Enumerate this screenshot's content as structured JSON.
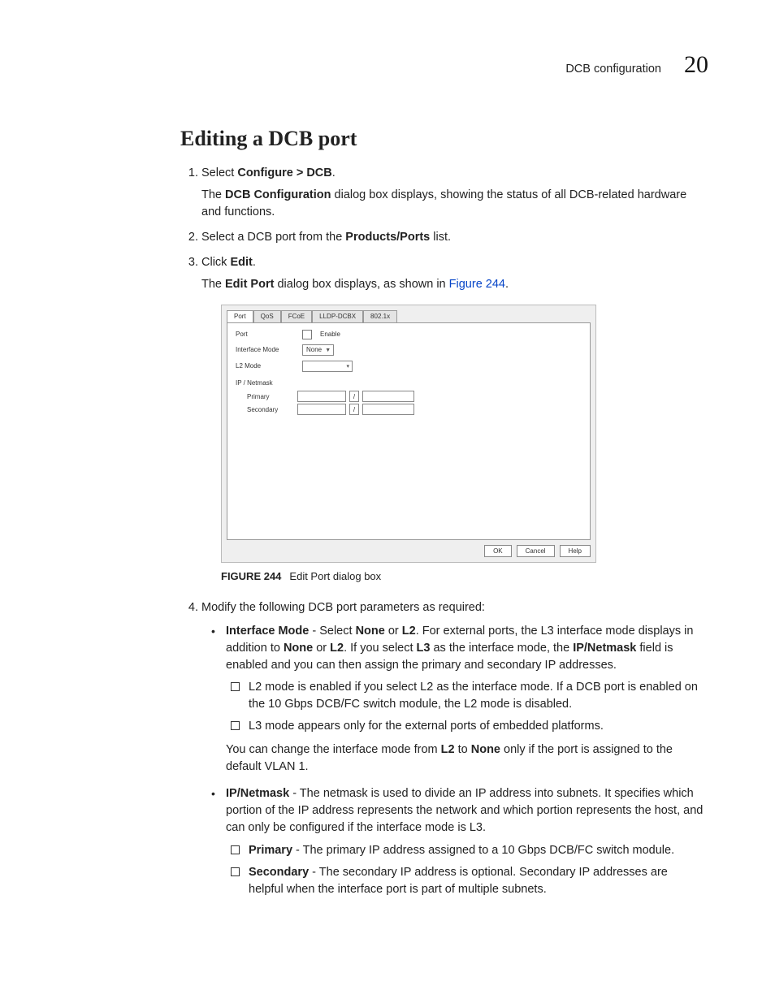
{
  "header": {
    "section": "DCB configuration",
    "chapter": "20"
  },
  "title": "Editing a DCB port",
  "steps": {
    "s1": {
      "text_a": "Select ",
      "bold": "Configure > DCB",
      "text_b": "."
    },
    "s1_para": {
      "a": "The ",
      "b": "DCB Configuration",
      "c": " dialog box displays, showing the status of all DCB-related hardware and functions."
    },
    "s2": {
      "a": "Select a DCB port from the ",
      "b": "Products/Ports",
      "c": " list."
    },
    "s3": {
      "a": "Click ",
      "b": "Edit",
      "c": "."
    },
    "s3_para": {
      "a": "The ",
      "b": "Edit Port",
      "c": " dialog box displays, as shown in ",
      "link": "Figure 244",
      "d": "."
    },
    "s4": "Modify the following DCB port parameters as required:"
  },
  "figure": {
    "tabs": [
      "Port",
      "QoS",
      "FCoE",
      "LLDP-DCBX",
      "802.1x"
    ],
    "labels": {
      "port": "Port",
      "enable": "Enable",
      "ifmode": "Interface Mode",
      "ifmode_val": "None",
      "l2mode": "L2 Mode",
      "ipnet": "IP / Netmask",
      "primary": "Primary",
      "secondary": "Secondary",
      "slash": "/"
    },
    "buttons": {
      "ok": "OK",
      "cancel": "Cancel",
      "help": "Help"
    },
    "caption_num": "FIGURE 244",
    "caption_text": "Edit Port dialog box"
  },
  "bullets": {
    "b1": {
      "lead": "Interface Mode",
      "t1": " - Select ",
      "none": "None",
      "or": " or ",
      "l2": "L2",
      "t2": ". For external ports, the L3 interface mode displays in addition to ",
      "t3": ". If you select ",
      "l3": "L3",
      "t4": " as the interface mode, the ",
      "ipn": "IP/Netmask",
      "t5": " field is enabled and you can then assign the primary and secondary IP addresses.",
      "box1": "L2 mode is enabled if you select L2 as the interface mode. If a DCB port is enabled on the 10 Gbps DCB/FC switch module, the L2 mode is disabled.",
      "box2": "L3 mode appears only for the external ports of embedded platforms.",
      "tail_a": "You can change the interface mode from ",
      "tail_l2": "L2",
      "tail_to": " to ",
      "tail_none": "None",
      "tail_b": " only if the port is assigned to the default VLAN 1."
    },
    "b2": {
      "lead": "IP/Netmask",
      "t1": " - The netmask is used to divide an IP address into subnets. It specifies which portion of the IP address represents the network and which portion represents the host, and can only be configured if the interface mode is L3.",
      "box1_lead": "Primary",
      "box1_t": " - The primary IP address assigned to a 10 Gbps DCB/FC switch module.",
      "box2_lead": "Secondary",
      "box2_t": " - The secondary IP address is optional. Secondary IP addresses are helpful when the interface port is part of multiple subnets."
    }
  }
}
